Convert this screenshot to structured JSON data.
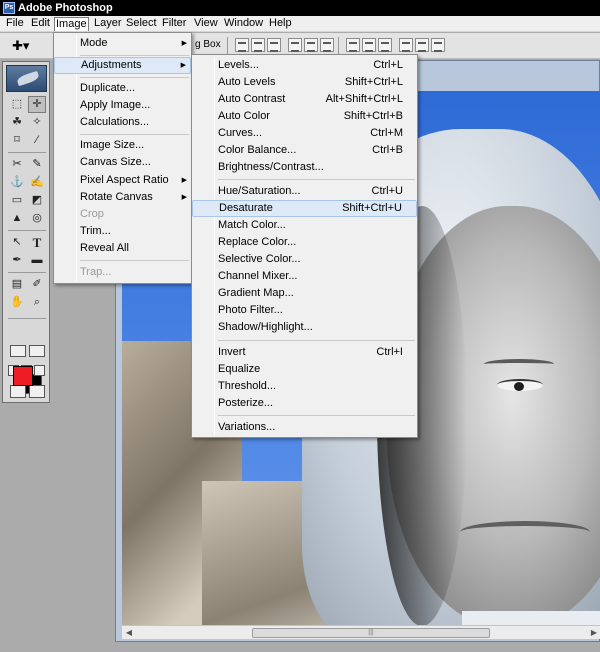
{
  "app": {
    "title": "Adobe Photoshop",
    "logo_text": "Ps"
  },
  "menubar": [
    "File",
    "Edit",
    "Image",
    "Layer",
    "Select",
    "Filter",
    "View",
    "Window",
    "Help"
  ],
  "optionsbar": {
    "tool_icon": "move-tool-icon",
    "bbox_label": "g Box"
  },
  "image_menu": {
    "items": [
      {
        "label": "Mode",
        "submenu": true
      },
      {
        "label": "Adjustments",
        "submenu": true,
        "highlighted": true
      },
      {
        "label": "Duplicate..."
      },
      {
        "label": "Apply Image..."
      },
      {
        "label": "Calculations..."
      },
      {
        "label": "Image Size..."
      },
      {
        "label": "Canvas Size..."
      },
      {
        "label": "Pixel Aspect Ratio",
        "submenu": true
      },
      {
        "label": "Rotate Canvas",
        "submenu": true
      },
      {
        "label": "Crop",
        "disabled": true
      },
      {
        "label": "Trim..."
      },
      {
        "label": "Reveal All"
      },
      {
        "label": "Trap...",
        "disabled": true
      }
    ]
  },
  "adjustments_menu": {
    "items": [
      {
        "label": "Levels...",
        "shortcut": "Ctrl+L"
      },
      {
        "label": "Auto Levels",
        "shortcut": "Shift+Ctrl+L"
      },
      {
        "label": "Auto Contrast",
        "shortcut": "Alt+Shift+Ctrl+L"
      },
      {
        "label": "Auto Color",
        "shortcut": "Shift+Ctrl+B"
      },
      {
        "label": "Curves...",
        "shortcut": "Ctrl+M"
      },
      {
        "label": "Color Balance...",
        "shortcut": "Ctrl+B"
      },
      {
        "label": "Brightness/Contrast...",
        "shortcut": ""
      },
      {
        "label": "Hue/Saturation...",
        "shortcut": "Ctrl+U"
      },
      {
        "label": "Desaturate",
        "shortcut": "Shift+Ctrl+U",
        "highlighted": true
      },
      {
        "label": "Match Color...",
        "shortcut": ""
      },
      {
        "label": "Replace Color...",
        "shortcut": ""
      },
      {
        "label": "Selective Color...",
        "shortcut": ""
      },
      {
        "label": "Channel Mixer...",
        "shortcut": ""
      },
      {
        "label": "Gradient Map...",
        "shortcut": ""
      },
      {
        "label": "Photo Filter...",
        "shortcut": ""
      },
      {
        "label": "Shadow/Highlight...",
        "shortcut": ""
      },
      {
        "label": "Invert",
        "shortcut": "Ctrl+I"
      },
      {
        "label": "Equalize",
        "shortcut": ""
      },
      {
        "label": "Threshold...",
        "shortcut": ""
      },
      {
        "label": "Posterize...",
        "shortcut": ""
      },
      {
        "label": "Variations...",
        "shortcut": ""
      }
    ]
  },
  "toolbox": {
    "tools": [
      "marquee",
      "move",
      "lasso",
      "magic-wand",
      "crop",
      "slice",
      "healing-brush",
      "brush",
      "clone-stamp",
      "history-brush",
      "eraser",
      "paint-bucket",
      "blur",
      "dodge",
      "path-selection",
      "type",
      "pen",
      "shape",
      "notes",
      "eyedropper",
      "hand",
      "zoom"
    ],
    "foreground_color": "#ee1c25",
    "background_color": "#000000"
  },
  "colors": {
    "menu_highlight": "#dde9f7",
    "titlebar": "#000000",
    "canvas_sky": "#2f6bd6"
  }
}
